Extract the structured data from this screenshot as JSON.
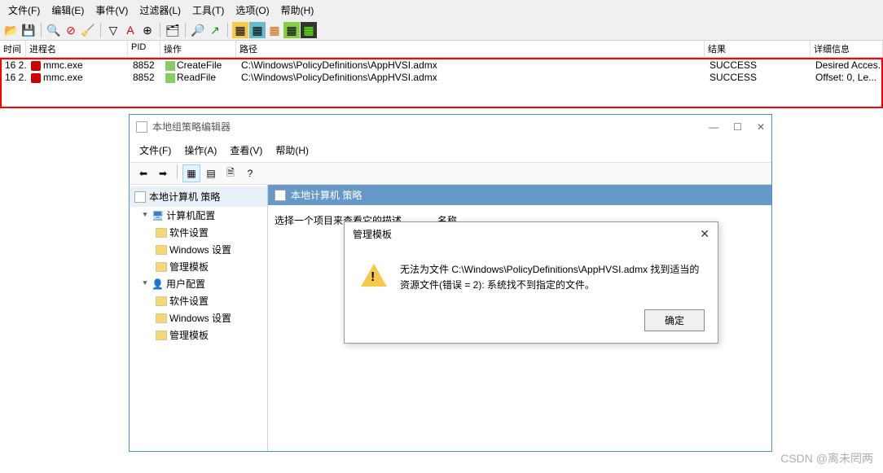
{
  "mainMenu": {
    "file": "文件(F)",
    "edit": "编辑(E)",
    "event": "事件(V)",
    "filter": "过滤器(L)",
    "tools": "工具(T)",
    "options": "选项(O)",
    "help": "帮助(H)"
  },
  "tableHeaders": {
    "time": "时间",
    "process": "进程名",
    "pid": "PID",
    "operation": "操作",
    "path": "路径",
    "result": "结果",
    "detail": "详细信息"
  },
  "rows": [
    {
      "time": "16 2...",
      "process": "mmc.exe",
      "pid": "8852",
      "operation": "CreateFile",
      "path": "C:\\Windows\\PolicyDefinitions\\AppHVSI.admx",
      "result": "SUCCESS",
      "detail": "Desired Acces..."
    },
    {
      "time": "16 2...",
      "process": "mmc.exe",
      "pid": "8852",
      "operation": "ReadFile",
      "path": "C:\\Windows\\PolicyDefinitions\\AppHVSI.admx",
      "result": "SUCCESS",
      "detail": "Offset: 0, Le..."
    }
  ],
  "gpedit": {
    "title": "本地组策略编辑器",
    "menu": {
      "file": "文件(F)",
      "action": "操作(A)",
      "view": "查看(V)",
      "help": "帮助(H)"
    },
    "treeHeader": "本地计算机 策略",
    "tree": {
      "computerConfig": "计算机配置",
      "softwareSettings": "软件设置",
      "windowsSettings": "Windows 设置",
      "adminTemplates": "管理模板",
      "userConfig": "用户配置"
    },
    "rpaneHeader": "本地计算机 策略",
    "hint": "选择一个项目来查看它的描述。",
    "nameCol": "名称"
  },
  "dialog": {
    "title": "管理模板",
    "message": "无法为文件 C:\\Windows\\PolicyDefinitions\\AppHVSI.admx 找到适当的资源文件(错误 = 2): 系统找不到指定的文件。",
    "ok": "确定"
  },
  "watermark": "CSDN @离未罔两"
}
